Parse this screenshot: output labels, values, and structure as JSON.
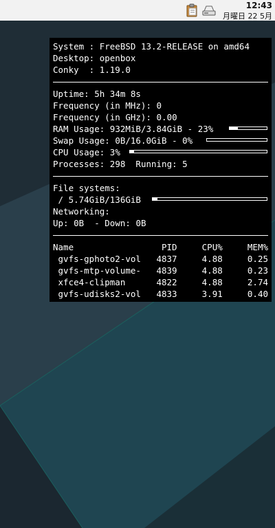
{
  "panel": {
    "time": "12:43",
    "date": "月曜日 22 5月"
  },
  "conky": {
    "system": [
      {
        "label": "System : ",
        "value": "FreeBSD 13.2-RELEASE on amd64"
      },
      {
        "label": "Desktop: ",
        "value": "openbox"
      },
      {
        "label": "Conky  : ",
        "value": "1.19.0"
      }
    ],
    "stats": {
      "uptime_label": "Uptime: ",
      "uptime": "5h 34m 8s",
      "freq_mhz_label": "Frequency (in MHz): ",
      "freq_mhz": "0",
      "freq_ghz_label": "Frequency (in GHz): ",
      "freq_ghz": "0.00",
      "ram_label": "RAM Usage: ",
      "ram": "932MiB/3.84GiB - 23%",
      "ram_pct": 23,
      "swap_label": "Swap Usage: ",
      "swap": "0B/16.0GiB - 0%",
      "swap_pct": 0,
      "cpu_label": "CPU Usage: ",
      "cpu": "3%",
      "cpu_pct": 3,
      "processes_label": "Processes: ",
      "processes": "298",
      "running_label": "  Running: ",
      "running": "5"
    },
    "fs": {
      "label": "File systems:",
      "root": " / 5.74GiB/136GiB",
      "root_pct": 4,
      "net_label": "Networking:",
      "up_label": "Up: ",
      "up": "0B",
      "down_label": "  - Down: ",
      "down": "0B"
    },
    "procs": {
      "headers": [
        "Name",
        "PID",
        "CPU%",
        "MEM%"
      ],
      "rows": [
        {
          "name": " gvfs-gphoto2-vol",
          "pid": "4837",
          "cpu": "4.88",
          "mem": "0.25"
        },
        {
          "name": " gvfs-mtp-volume-",
          "pid": "4839",
          "cpu": "4.88",
          "mem": "0.23"
        },
        {
          "name": " xfce4-clipman",
          "pid": "4822",
          "cpu": "4.88",
          "mem": "2.74"
        },
        {
          "name": " gvfs-udisks2-vol",
          "pid": "4833",
          "cpu": "3.91",
          "mem": "0.40"
        }
      ]
    }
  }
}
